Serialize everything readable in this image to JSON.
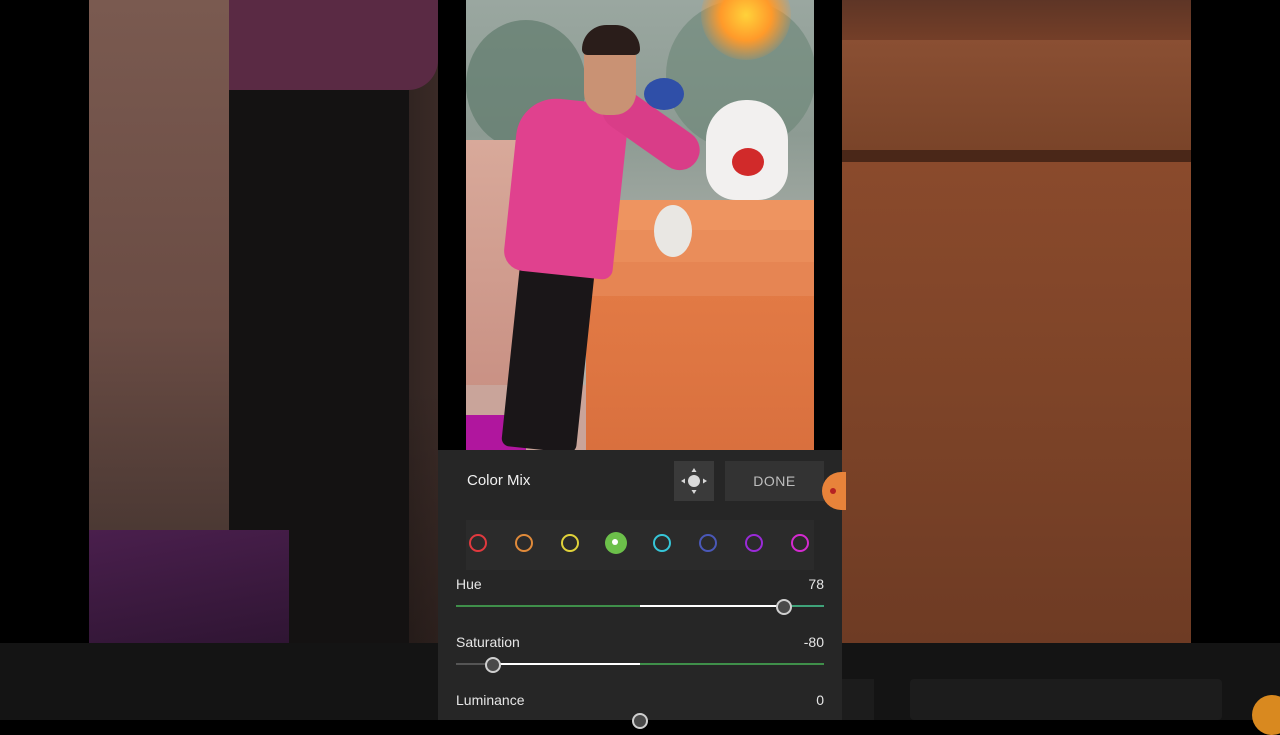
{
  "panel": {
    "title": "Color Mix",
    "done_label": "DONE",
    "target_icon": "target-adjust-icon"
  },
  "colors": [
    {
      "name": "red",
      "color": "#e0393e",
      "selected": false
    },
    {
      "name": "orange",
      "color": "#e08a3a",
      "selected": false
    },
    {
      "name": "yellow",
      "color": "#e0d23a",
      "selected": false
    },
    {
      "name": "green",
      "color": "#6cc04a",
      "selected": true
    },
    {
      "name": "aqua",
      "color": "#36c6d8",
      "selected": false
    },
    {
      "name": "blue",
      "color": "#4a58b8",
      "selected": false
    },
    {
      "name": "purple",
      "color": "#9a2ad8",
      "selected": false
    },
    {
      "name": "magenta",
      "color": "#d42ad0",
      "selected": false
    }
  ],
  "sliders": {
    "hue": {
      "label": "Hue",
      "value": "78",
      "fraction": 0.89,
      "colors": [
        "#3f8f4a",
        "#ffffff",
        "#3fa37a"
      ]
    },
    "saturation": {
      "label": "Saturation",
      "value": "-80",
      "fraction": 0.1,
      "colors": [
        "#555555",
        "#ffffff",
        "#3f8f4a"
      ]
    },
    "luminance": {
      "label": "Luminance",
      "value": "0",
      "fraction": 0.5
    }
  }
}
